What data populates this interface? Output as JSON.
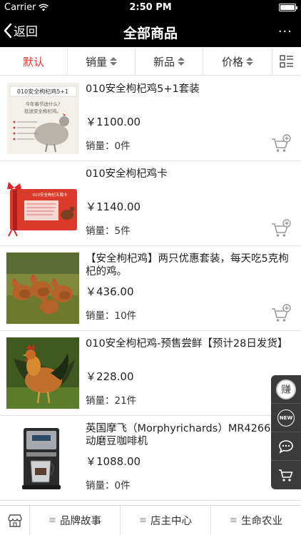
{
  "status_bar": {
    "carrier": "Carrier",
    "time": "2:50 PM"
  },
  "nav": {
    "back_label": "返回",
    "title": "全部商品",
    "more_label": "···"
  },
  "sort_tabs": [
    {
      "label": "默认",
      "active": true
    },
    {
      "label": "销量"
    },
    {
      "label": "新品"
    },
    {
      "label": "价格"
    }
  ],
  "products": [
    {
      "name": "010安全枸杞鸡5+1套装",
      "price": "￥1100.00",
      "sales_label": "销量：",
      "sales_value": "0件",
      "image": "chicken-gift-box-icon"
    },
    {
      "name": "010安全枸杞鸡卡",
      "price": "￥1140.00",
      "sales_label": "销量：",
      "sales_value": "5件",
      "image": "gift-card-icon"
    },
    {
      "name": "【安全枸杞鸡】两只优惠套装，每天吃5克枸杞的鸡。",
      "price": "￥436.00",
      "sales_label": "销量：",
      "sales_value": "10件",
      "image": "hens-photo"
    },
    {
      "name": "010安全枸杞鸡-预售尝鲜【预计28日发货】",
      "price": "￥228.00",
      "sales_label": "销量：",
      "sales_value": "21件",
      "image": "rooster-photo"
    },
    {
      "name": "英国摩飞（Morphyrichards）MR4266全自动磨豆咖啡机",
      "price": "￥1088.00",
      "sales_label": "销量：",
      "sales_value": "0件",
      "image": "coffee-machine-photo"
    }
  ],
  "thumb_text": {
    "p1_title": "010安全枸杞鸡5+1",
    "p1_sub1": "今年春节送什么?",
    "p1_sub2": "就送安全枸杞鸡。",
    "p2_title": "010安全枸杞五周卡"
  },
  "float_buttons": {
    "earn_label": "赚",
    "new_label": "NEW"
  },
  "bottom_tabs": [
    {
      "label": "品牌故事"
    },
    {
      "label": "店主中心"
    },
    {
      "label": "生命农业"
    }
  ],
  "colors": {
    "accent": "#e03a3a",
    "topbar": "#000000",
    "float": "#3b3b3b"
  }
}
